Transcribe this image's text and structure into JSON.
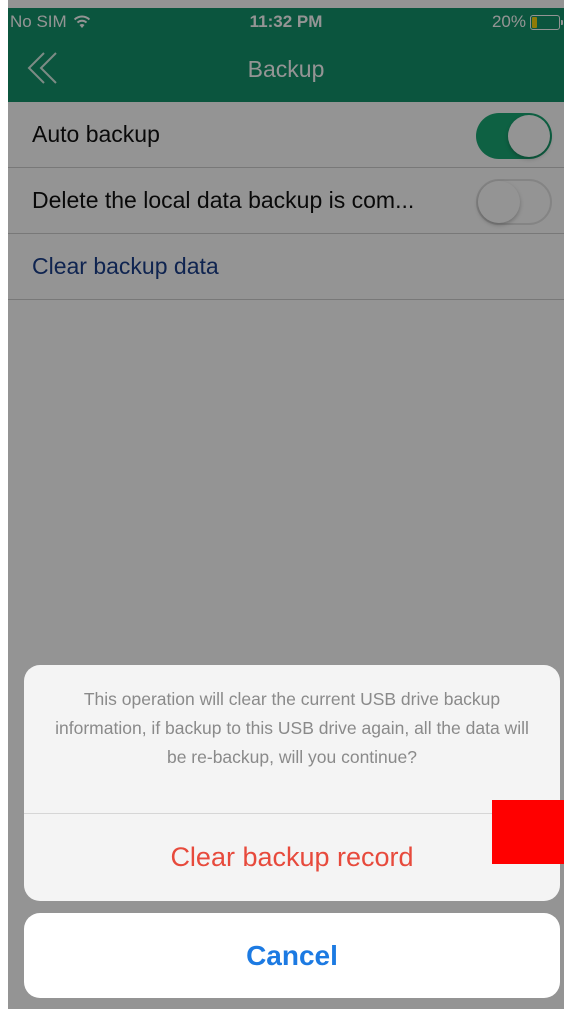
{
  "status_bar": {
    "carrier": "No SIM",
    "time": "11:32 PM",
    "battery": "20%",
    "battery_level": 0.2,
    "wifi_icon": "wifi-icon",
    "battery_icon": "battery-icon"
  },
  "nav": {
    "title": "Backup",
    "back_icon": "double-chevron-left-icon"
  },
  "settings": {
    "auto_backup": {
      "label": "Auto backup",
      "enabled": true
    },
    "delete_local": {
      "label": "Delete the local data backup is com...",
      "enabled": false
    },
    "clear_backup_data": {
      "label": "Clear backup data"
    }
  },
  "action_sheet": {
    "message": "This operation will clear the current USB drive backup information, if backup to this USB drive again, all the data will be re-backup, will you continue?",
    "destructive_action": "Clear backup record",
    "cancel": "Cancel"
  },
  "colors": {
    "header": "#14936b",
    "toggle_on": "#19a874",
    "link": "#1b3f8a",
    "destructive": "#e74a3c",
    "cancel": "#1c7ae2",
    "marker": "#ff0000"
  }
}
